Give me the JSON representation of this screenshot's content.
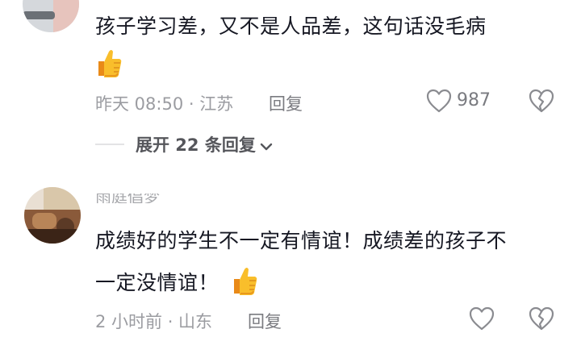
{
  "comments": [
    {
      "text": "孩子学习差，又不是人品差，这句话没毛病",
      "emoji": "thumbs-up",
      "time_location": "昨天 08:50 · 江苏",
      "reply_label": "回复",
      "like_count": "987",
      "expand_label": "展开 22 条回复"
    },
    {
      "username": "雨庭倡梦",
      "text_line1": "成绩好的学生不一定有情谊！成绩差的孩子不",
      "text_line2": "一定没情谊！",
      "emoji": "thumbs-up",
      "time_location": "2 小时前 · 山东",
      "reply_label": "回复"
    }
  ],
  "icons": {
    "like": "heart-outline-icon",
    "dislike": "broken-heart-icon",
    "expand": "chevron-down-icon"
  },
  "colors": {
    "text": "#161823",
    "meta": "#9b9ca1",
    "thumb": "#f5b01e"
  }
}
